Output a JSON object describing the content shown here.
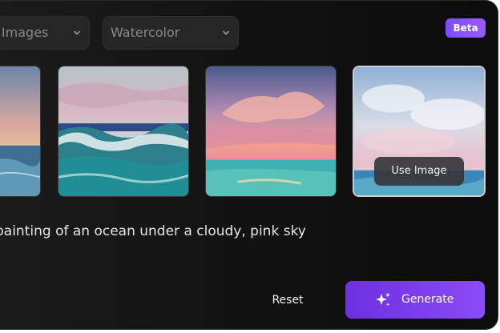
{
  "filters": {
    "source_value": "e Images",
    "style_value": "Watercolor"
  },
  "badge": "Beta",
  "overlay_button": "Use Image",
  "prompt_text": "painting of an ocean under a cloudy, pink sky",
  "actions": {
    "reset_label": "Reset",
    "generate_label": "Generate"
  },
  "colors": {
    "accent": "#7c4dff",
    "button_gradient_start": "#6d2fe0",
    "button_gradient_end": "#8b4cf7"
  },
  "icons": {
    "dropdown": "chevron-down-icon",
    "generate": "sparkle-icon"
  }
}
